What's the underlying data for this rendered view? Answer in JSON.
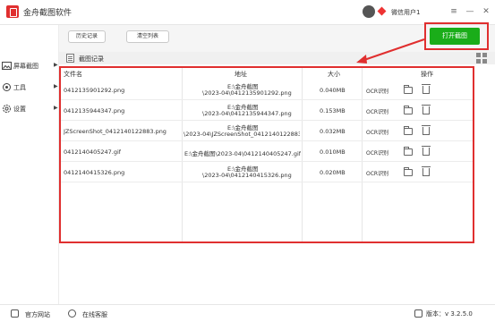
{
  "app": {
    "title": "金舟截图软件",
    "username": "微信用户1",
    "window_buttons": [
      "≡",
      "—",
      "✕"
    ]
  },
  "toolbar": {
    "history_label": "历史记录",
    "clear_label": "清空列表",
    "capture_label": "打开截图"
  },
  "sidebar": {
    "items": [
      {
        "label": "屏幕截图",
        "icon": "image-icon"
      },
      {
        "label": "工具",
        "icon": "tools-icon"
      },
      {
        "label": "设置",
        "icon": "gear-icon"
      }
    ]
  },
  "section": {
    "title": "截图记录"
  },
  "table": {
    "headers": {
      "name": "文件名",
      "path": "地址",
      "size": "大小",
      "ops": "操作"
    },
    "ocr_label": "OCR识别",
    "rows": [
      {
        "name": "0412135901292.png",
        "path1": "E:\\金舟截图",
        "path2": "\\2023-04\\0412135901292.png",
        "size": "0.040MB"
      },
      {
        "name": "0412135944347.png",
        "path1": "E:\\金舟截图",
        "path2": "\\2023-04\\0412135944347.png",
        "size": "0.153MB"
      },
      {
        "name": "JZScreenShot_0412140122883.png",
        "path1": "E:\\金舟截图",
        "path2": "\\2023-04\\JZScreenShot_0412140122883...",
        "size": "0.032MB"
      },
      {
        "name": "0412140405247.gif",
        "path1": "E:\\金舟截图\\2023-04\\0412140405247.gif",
        "path2": "",
        "size": "0.010MB"
      },
      {
        "name": "0412140415326.png",
        "path1": "E:\\金舟截图",
        "path2": "\\2023-04\\0412140415326.png",
        "size": "0.020MB"
      }
    ]
  },
  "footer": {
    "website": "官方网站",
    "support": "在线客服",
    "version": "版本：v 3.2.5.0"
  },
  "colors": {
    "accent": "#1aad19",
    "highlight": "#e02f2f"
  }
}
